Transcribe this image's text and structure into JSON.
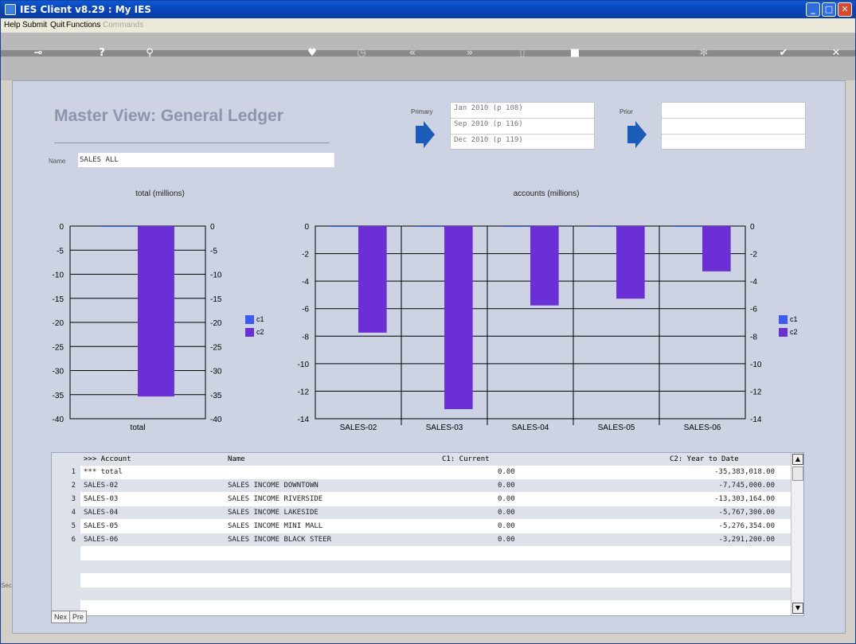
{
  "window": {
    "title": "IES Client v8.29 : My IES"
  },
  "menu": {
    "help": "Help",
    "submit": "Submit",
    "quit": "Quit",
    "functions": "Functions",
    "commands": "Commands"
  },
  "page": {
    "title": "Master View: General Ledger",
    "name_label": "Name",
    "name_value": "SALES ALL"
  },
  "periods": {
    "primary_label": "Primary",
    "primary": [
      "Jan 2010 (p 108)",
      "Sep 2010 (p 116)",
      "Dec 2010 (p 119)"
    ],
    "prior_label": "Prior",
    "prior": [
      "",
      "",
      ""
    ]
  },
  "legend": {
    "c1": "c1",
    "c2": "c2",
    "c1_color": "#3b5bf5",
    "c2_color": "#6b2fd6"
  },
  "chart_data": [
    {
      "type": "bar",
      "title": "total (millions)",
      "categories": [
        "total"
      ],
      "series": [
        {
          "name": "c1",
          "values": [
            0
          ]
        },
        {
          "name": "c2",
          "values": [
            -35.383
          ]
        }
      ],
      "ylim": [
        -40,
        0
      ],
      "yticks": [
        0,
        -5,
        -10,
        -15,
        -20,
        -25,
        -30,
        -35,
        -40
      ]
    },
    {
      "type": "bar",
      "title": "accounts (millions)",
      "categories": [
        "SALES-02",
        "SALES-03",
        "SALES-04",
        "SALES-05",
        "SALES-06"
      ],
      "series": [
        {
          "name": "c1",
          "values": [
            0,
            0,
            0,
            0,
            0
          ]
        },
        {
          "name": "c2",
          "values": [
            -7.745,
            -13.303,
            -5.767,
            -5.276,
            -3.291
          ]
        }
      ],
      "ylim": [
        -14,
        0
      ],
      "yticks": [
        0,
        -2,
        -4,
        -6,
        -8,
        -10,
        -12,
        -14
      ]
    }
  ],
  "table": {
    "headers": {
      "account": ">>> Account",
      "name": "Name",
      "c1": "C1: Current",
      "c2": "C2: Year to Date"
    },
    "rows": [
      {
        "num": "1",
        "account": "*** total",
        "name": "",
        "c1": "0.00",
        "c2": "-35,383,018.00"
      },
      {
        "num": "2",
        "account": "SALES-02",
        "name": "SALES INCOME DOWNTOWN",
        "c1": "0.00",
        "c2": "-7,745,000.00"
      },
      {
        "num": "3",
        "account": "SALES-03",
        "name": "SALES INCOME RIVERSIDE",
        "c1": "0.00",
        "c2": "-13,303,164.00"
      },
      {
        "num": "4",
        "account": "SALES-04",
        "name": "SALES INCOME LAKESIDE",
        "c1": "0.00",
        "c2": "-5,767,300.00"
      },
      {
        "num": "5",
        "account": "SALES-05",
        "name": "SALES INCOME MINI MALL",
        "c1": "0.00",
        "c2": "-5,276,354.00"
      },
      {
        "num": "6",
        "account": "SALES-06",
        "name": "SALES INCOME BLACK STEER",
        "c1": "0.00",
        "c2": "-3,291,200.00"
      }
    ]
  },
  "nav": {
    "next": "Nex",
    "prev": "Pre"
  },
  "side": {
    "label": "Sec"
  }
}
